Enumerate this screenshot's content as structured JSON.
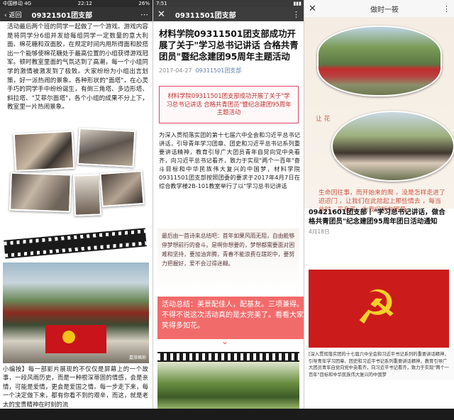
{
  "panel1": {
    "status_left": "中国移动 4G",
    "status_time": "22:12",
    "status_right": "26%",
    "back_label": "返回",
    "title": "09321501团支部",
    "body": "活动最后两个班的同学一起做了一个游戏。游戏内容是将同学分6组并发给每组同学一定数量的意大利面、棉花糖和双面胶，在规定时间内用所得面和胶搭出一个能够使棉花糖处于最高位置的小组获得游戏冠军。顿时教室里面的气氛达到了高潮，每一个小组同学的激情被激发到了极致。大家纷纷为小组出言划策，好一派热闹的景象。各种形状的\"面塔\"，在心灵手巧的同学手中纷纷诞生，有倒三角塔、多边形塔、斜拉塔、\"艾菲尔面塔\"，各个小组的成果不分上下，教室里一片热闹景象。",
    "caption": "小编按】每一部影片展现的不仅仅是屏幕上的一个故事，一段风雨历史，而是一种根深蒂固的情感，会是亲情，可能是爱情，更会是爱国之情。每一步走下来，每一个决定做下来，都有你看不到的艰辛，而这，就是老太的宝贵精神在时刻的流",
    "watermark": "嘉旅格助"
  },
  "panel2": {
    "status_time": "7:51",
    "title": "09311501团支部",
    "article_title": "材料学院09311501团支部成功开展了关于\"学习总书记讲话 合格共青团员\"暨纪念建团95周年主题活动",
    "date": "2017-04-27",
    "author": "09311501团支部",
    "boxed_title": "材料学院09311501团支部成功开展了关于\"学习总书记讲话 合格共青团员\"暨纪念建团95周年主题活动",
    "body": "为深入贯彻落实团的第十七届六中全会和习近平总书记讲话，引导青年学习团章、团史和习近平总书记系列重要讲话精神，教育引导广大团员青年自觉向党中央看齐，向习近平总书记看齐，致力于实现\"两个一百年\"奋斗目标和中华民族伟大复兴的中国梦，材料学院09311501团支部按照团委的要求于2017年4月7日在综合教学楼2B-101教室举行了以\"学习总书记讲话",
    "poem": "最后由一首诗来总结吧：首年如果风雨无阻，自由能够停梦想前行的奋斗。是啊你想要的，梦想都需要面对困难和坚持，要加油奔腾，青春不能浪费在蹉跎中，要努力把握好，爱不会过得迷糊。",
    "banner_text": "活动总结：美景配佳人，配基友。三项兼得。不得不说这次活动真的是太完美了。看看大家笑得多如花。"
  },
  "panel3": {
    "title": "做时一筱",
    "handwrite1": "让 花",
    "handwrite2": "生命因往事，而开始来的爬 ，没是怎样走进了迢迢门 ，让我们在此拾起上那些情去 ，每当此时，平身平，为我们所有团员 。",
    "article_title": "09421601团支部丨\"学习总书记讲话，做合格共青团员\"纪念建团95周年团日活动通知",
    "date": "4月18日",
    "body": "[深入贯彻落实团的十七届六中全会和习近平书记系列的重要讲话精神，引导青年学习团章、团史和习近平书记系列重要讲话精神，教育引导广大团员青年自觉向党中央看齐，向习近平书记看齐，致力于实现\"两个一百年\"目标和中华民族伟大复兴的中国梦"
  }
}
